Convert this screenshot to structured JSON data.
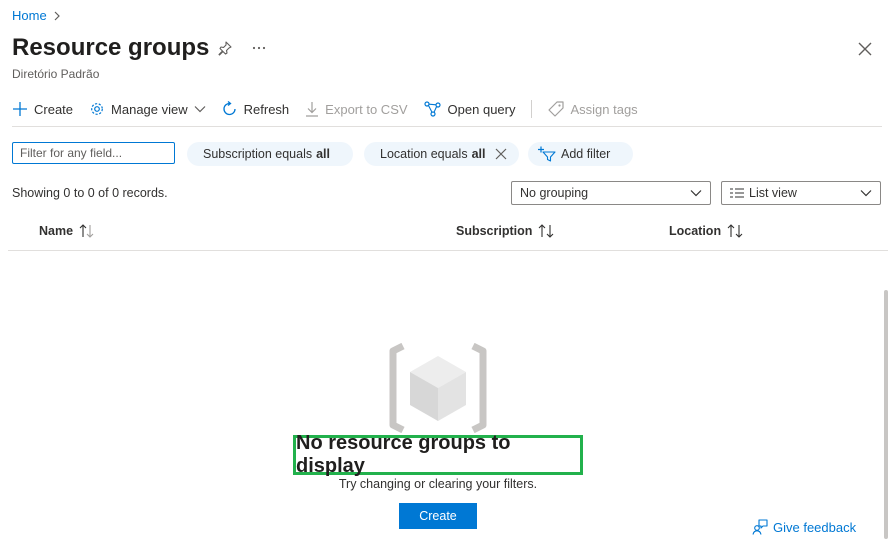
{
  "breadcrumb": {
    "home": "Home"
  },
  "header": {
    "title": "Resource groups",
    "subtitle": "Diretório Padrão"
  },
  "toolbar": {
    "create": "Create",
    "manage_view": "Manage view",
    "refresh": "Refresh",
    "export_csv": "Export to CSV",
    "open_query": "Open query",
    "assign_tags": "Assign tags"
  },
  "filters": {
    "search_placeholder": "Filter for any field...",
    "subscription_label": "Subscription equals",
    "subscription_value": "all",
    "location_label": "Location equals",
    "location_value": "all",
    "add_filter": "Add filter"
  },
  "records_text": "Showing 0 to 0 of 0 records.",
  "grouping": {
    "selected": "No grouping"
  },
  "view": {
    "selected": "List view"
  },
  "table": {
    "columns": [
      "Name",
      "Subscription",
      "Location"
    ]
  },
  "empty": {
    "title": "No resource groups to display",
    "subtitle": "Try changing or clearing your filters.",
    "create_button": "Create"
  },
  "feedback": "Give feedback",
  "colors": {
    "accent": "#0078d4",
    "highlight_box": "#22b14c",
    "pill_bg": "#eff6fc"
  }
}
